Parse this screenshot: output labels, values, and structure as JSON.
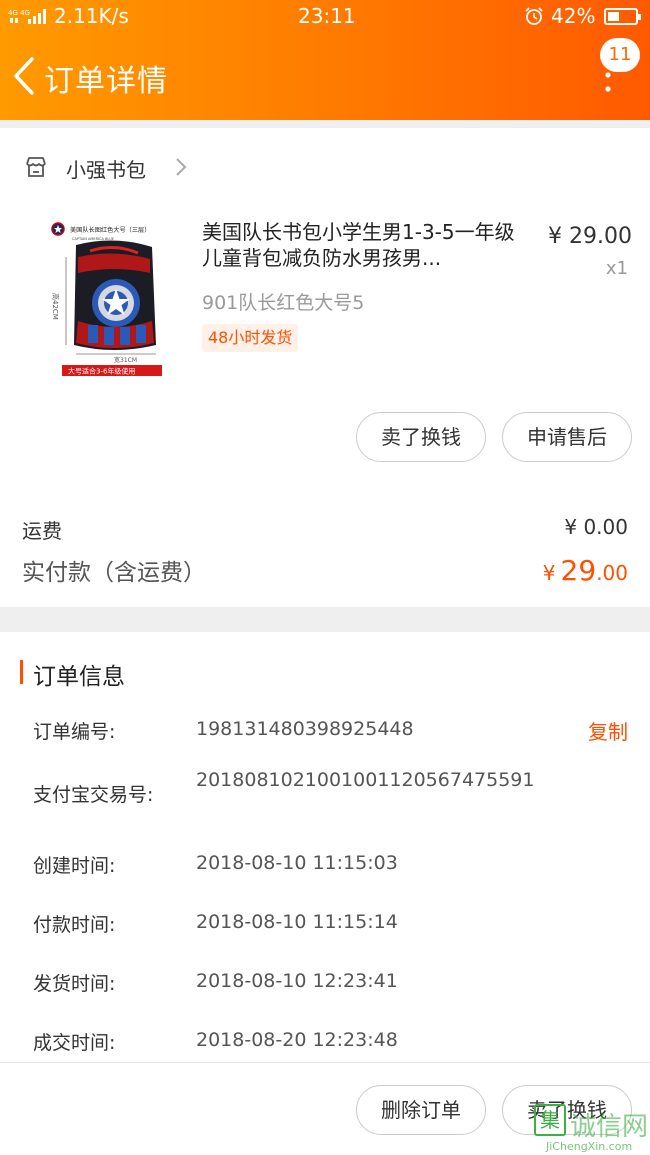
{
  "status_bar": {
    "network": "4G 4G",
    "speed": "2.11K/s",
    "time": "23:11",
    "battery": "42%",
    "battery_level": 0.42
  },
  "header": {
    "title": "订单详情",
    "badge_count": "11"
  },
  "shop": {
    "name": "小强书包"
  },
  "product": {
    "title": "美国队长书包小学生男1-3-5一年级儿童背包减负防水男孩男...",
    "sku": "901队长红色大号5",
    "shipping_tag": "48小时发货",
    "price": "¥ 29.00",
    "quantity": "x1",
    "image_label_top": "美国队长图红色大号（三层）",
    "image_label_bottom": "大号适合3-6年级使用",
    "image_dim_height": "高42CM",
    "image_dim_width": "宽31CM"
  },
  "actions_top": {
    "sell": "卖了换钱",
    "after_sale": "申请售后"
  },
  "summary": {
    "fee_label": "运费",
    "fee_value": "¥ 0.00",
    "paid_label": "实付款（含运费）",
    "paid_currency": "¥",
    "paid_integer": "29",
    "paid_decimal": ".00"
  },
  "order_info": {
    "title": "订单信息",
    "copy_label": "复制",
    "rows": [
      {
        "label": "订单编号:",
        "value": "198131480398925448"
      },
      {
        "label": "支付宝交易号:",
        "value": "2018081021001001120567475591"
      },
      {
        "label": "创建时间:",
        "value": "2018-08-10 11:15:03"
      },
      {
        "label": "付款时间:",
        "value": "2018-08-10 11:15:14"
      },
      {
        "label": "发货时间:",
        "value": "2018-08-10 12:23:41"
      },
      {
        "label": "成交时间:",
        "value": "2018-08-20 12:23:48"
      }
    ]
  },
  "actions_bottom": {
    "delete": "删除订单",
    "sell": "卖了换钱"
  },
  "watermark": {
    "logo_char": "集",
    "text": "诚信网",
    "url": "JiChengXin.com"
  },
  "colors": {
    "accent": "#ff5000",
    "header_start": "#ff9a00",
    "header_end": "#ff5a00"
  }
}
